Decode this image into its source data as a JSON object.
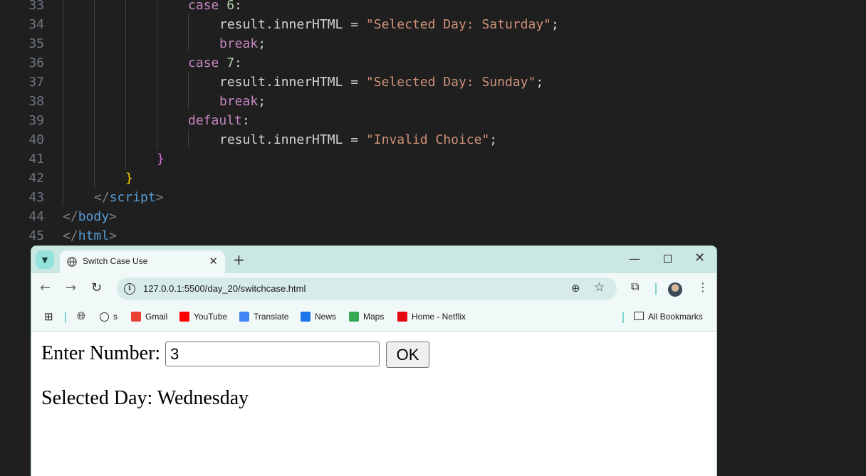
{
  "editor": {
    "lines": [
      {
        "n": "33",
        "tokens": [
          {
            "t": "case",
            "c": "ctl"
          },
          {
            "t": " "
          },
          {
            "t": "6",
            "c": "num"
          },
          {
            "t": ":",
            "c": "txt"
          }
        ]
      },
      {
        "n": "34",
        "tokens": [
          {
            "t": "result.innerHTML = ",
            "c": "txt"
          },
          {
            "t": "\"Selected Day: Saturday\"",
            "c": "str"
          },
          {
            "t": ";",
            "c": "txt"
          }
        ]
      },
      {
        "n": "35",
        "tokens": [
          {
            "t": "break",
            "c": "ctl"
          },
          {
            "t": ";",
            "c": "txt"
          }
        ]
      },
      {
        "n": "36",
        "tokens": [
          {
            "t": "case",
            "c": "ctl"
          },
          {
            "t": " "
          },
          {
            "t": "7",
            "c": "num"
          },
          {
            "t": ":",
            "c": "txt"
          }
        ]
      },
      {
        "n": "37",
        "tokens": [
          {
            "t": "result.innerHTML = ",
            "c": "txt"
          },
          {
            "t": "\"Selected Day: Sunday\"",
            "c": "str"
          },
          {
            "t": ";",
            "c": "txt"
          }
        ]
      },
      {
        "n": "38",
        "tokens": [
          {
            "t": "break",
            "c": "ctl"
          },
          {
            "t": ";",
            "c": "txt"
          }
        ]
      },
      {
        "n": "39",
        "tokens": [
          {
            "t": "default",
            "c": "ctl"
          },
          {
            "t": ":",
            "c": "txt"
          }
        ]
      },
      {
        "n": "40",
        "tokens": [
          {
            "t": "result.innerHTML = ",
            "c": "txt"
          },
          {
            "t": "\"Invalid Choice\"",
            "c": "str"
          },
          {
            "t": ";",
            "c": "txt"
          }
        ]
      },
      {
        "n": "41",
        "tokens": [
          {
            "t": "}",
            "c": "brace1"
          }
        ]
      },
      {
        "n": "42",
        "tokens": [
          {
            "t": "}",
            "c": "brace2"
          }
        ]
      },
      {
        "n": "43",
        "tokens": [
          {
            "t": "</",
            "c": "pun"
          },
          {
            "t": "script",
            "c": "tag"
          },
          {
            "t": ">",
            "c": "pun"
          }
        ]
      },
      {
        "n": "44",
        "tokens": [
          {
            "t": "</",
            "c": "pun"
          },
          {
            "t": "body",
            "c": "tag"
          },
          {
            "t": ">",
            "c": "pun"
          }
        ]
      },
      {
        "n": "45",
        "tokens": [
          {
            "t": "</",
            "c": "pun"
          },
          {
            "t": "html",
            "c": "tag"
          },
          {
            "t": ">",
            "c": "pun"
          }
        ]
      }
    ]
  },
  "browser": {
    "tab_title": "Switch Case Use",
    "new_tab_icon": "+",
    "url": "127.0.0.1:5500/day_20/switchcase.html",
    "bookmarks": [
      {
        "label": "s",
        "icon": "history-icon"
      },
      {
        "label": "Gmail",
        "icon": "gmail-icon",
        "color": "#ea4335"
      },
      {
        "label": "YouTube",
        "icon": "youtube-icon",
        "color": "#ff0000"
      },
      {
        "label": "Translate",
        "icon": "translate-icon",
        "color": "#4285f4"
      },
      {
        "label": "News",
        "icon": "news-icon",
        "color": "#1a73e8"
      },
      {
        "label": "Maps",
        "icon": "maps-icon",
        "color": "#34a853"
      },
      {
        "label": "Home - Netflix",
        "icon": "netflix-icon",
        "color": "#e50914"
      }
    ],
    "all_bookmarks": "All Bookmarks"
  },
  "page": {
    "label": "Enter Number:",
    "input_value": "3",
    "button_label": "OK",
    "result": "Selected Day: Wednesday"
  },
  "colors": {
    "editor_bg": "#1f1f1f",
    "keyword": "#c586c0",
    "string": "#ce9178",
    "tag": "#569cd6",
    "tab_strip": "#cae7e2"
  }
}
